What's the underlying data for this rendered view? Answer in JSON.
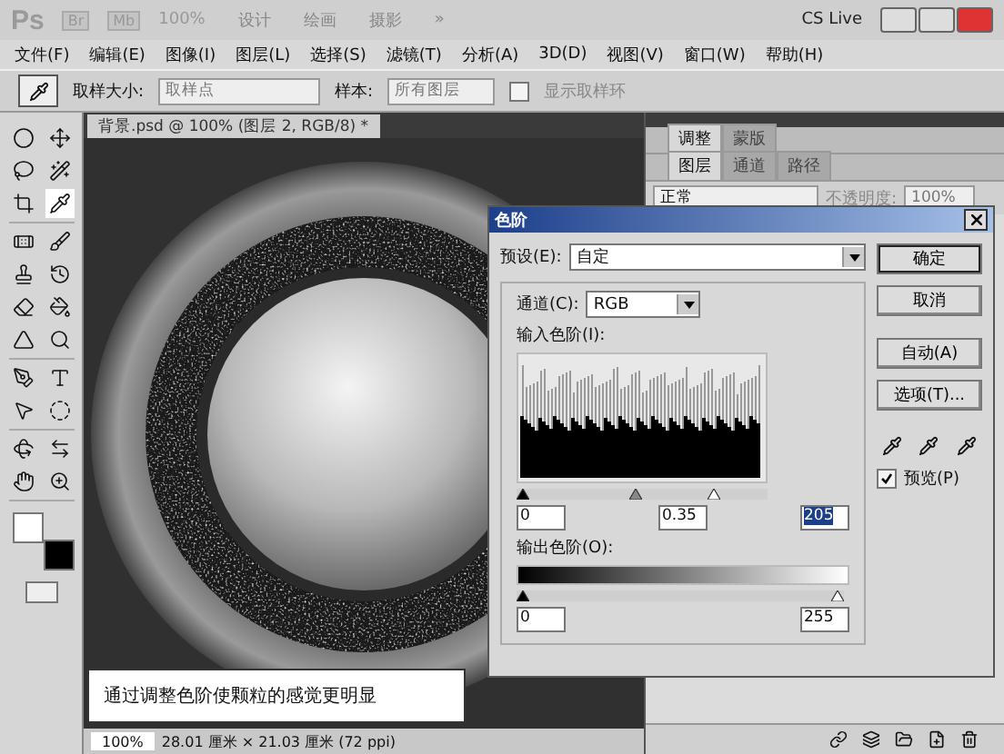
{
  "app_bar": {
    "logo": "Ps",
    "bridge": "Br",
    "mini": "Mb",
    "zoom": "100%",
    "workspaces": [
      {
        "label": "设计"
      },
      {
        "label": "绘画"
      },
      {
        "label": "摄影"
      }
    ],
    "more": "»",
    "cs_live": "CS Live"
  },
  "menu": [
    "文件(F)",
    "编辑(E)",
    "图像(I)",
    "图层(L)",
    "选择(S)",
    "滤镜(T)",
    "分析(A)",
    "3D(D)",
    "视图(V)",
    "窗口(W)",
    "帮助(H)"
  ],
  "options_bar": {
    "sample_size_label": "取样大小:",
    "sample_size": "取样点",
    "sample_label": "样本:",
    "sample": "所有图层",
    "show_ring": {
      "label": "显示取样环",
      "checked": false
    }
  },
  "document_tab": {
    "title": "背景.psd @ 100% (图层 2, RGB/8) *"
  },
  "panels": {
    "top_tabs": [
      {
        "label": "调整",
        "selected": true
      },
      {
        "label": "蒙版",
        "selected": false
      }
    ],
    "layer_tabs": [
      {
        "label": "图层",
        "selected": true
      },
      {
        "label": "通道",
        "selected": false
      },
      {
        "label": "路径",
        "selected": false
      }
    ],
    "blend_mode": "正常",
    "opacity_label": "不透明度:",
    "opacity": "100%"
  },
  "dialog": {
    "title": "色阶",
    "preset_label": "预设(E):",
    "preset": "自定",
    "channel_label": "通道(C):",
    "channel": "RGB",
    "input_label": "输入色阶(I):",
    "input_sliders": [
      {
        "level": 0
      },
      {
        "level": 0.47
      },
      {
        "level": 0.8
      }
    ],
    "input_values": [
      "0",
      "0.35",
      "205"
    ],
    "output_label": "输出色阶(O):",
    "output_sliders": [
      {
        "level": 0
      },
      {
        "level": 1
      }
    ],
    "output_values": [
      "0",
      "255"
    ],
    "buttons": [
      {
        "label": "确定",
        "default": true
      },
      {
        "label": "取消",
        "default": false
      },
      {
        "label": "自动(A)",
        "default": false
      },
      {
        "label": "选项(T)...",
        "default": false
      }
    ],
    "preview": {
      "label": "预览(P)",
      "checked": true
    }
  },
  "caption": "通过调整色阶使颗粒的感觉更明显",
  "status_bar": {
    "zoom": "100%",
    "info": "28.01 厘米 × 21.03 厘米 (72 ppi)"
  }
}
